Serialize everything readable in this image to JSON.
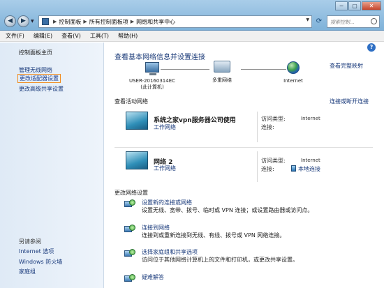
{
  "window": {
    "breadcrumbs": [
      "控制面板",
      "所有控制面板项",
      "网络和共享中心"
    ],
    "search_placeholder": "搜索控制...",
    "controls": [
      "−",
      "▢",
      "✕"
    ]
  },
  "menu": [
    "文件(F)",
    "编辑(E)",
    "查看(V)",
    "工具(T)",
    "帮助(H)"
  ],
  "sidebar": {
    "home": "控制面板主页",
    "links": [
      "管理无线网络",
      "更改适配器设置",
      "更改高级共享设置"
    ],
    "see_also_title": "另请参阅",
    "see_also": [
      "Internet 选项",
      "Windows 防火墙",
      "家庭组"
    ]
  },
  "main": {
    "title": "查看基本网络信息并设置连接",
    "full_map": "查看完整映射",
    "nodes": [
      {
        "label_line1": "USER-20160314EC",
        "label_line2": "(此计算机)"
      },
      {
        "label_line1": "多重网络",
        "label_line2": ""
      },
      {
        "label_line1": "Internet",
        "label_line2": ""
      }
    ],
    "active_title": "查看活动网络",
    "connect_disconnect": "连接或断开连接",
    "networks": [
      {
        "name": "系统之家vpn服务器公司使用",
        "type": "工作网络",
        "access_label": "访问类型:",
        "access_value": "Internet",
        "conn_label": "连接:",
        "conn_value": ""
      },
      {
        "name": "网络  2",
        "type": "工作网络",
        "access_label": "访问类型:",
        "access_value": "Internet",
        "conn_label": "连接:",
        "conn_value": "本地连接"
      }
    ],
    "change_title": "更改网络设置",
    "tasks": [
      {
        "link": "设置新的连接或网络",
        "desc": "设置无线、宽带、拨号、临时或 VPN 连接；或设置路由器或访问点。"
      },
      {
        "link": "连接到网络",
        "desc": "连接到或重新连接到无线、有线、拨号或 VPN 网络连接。"
      },
      {
        "link": "选择家庭组和共享选项",
        "desc": "访问位于其他网络计算机上的文件和打印机，或更改共享设置。"
      },
      {
        "link": "疑难解答",
        "desc": ""
      }
    ]
  },
  "help_icon": "?"
}
